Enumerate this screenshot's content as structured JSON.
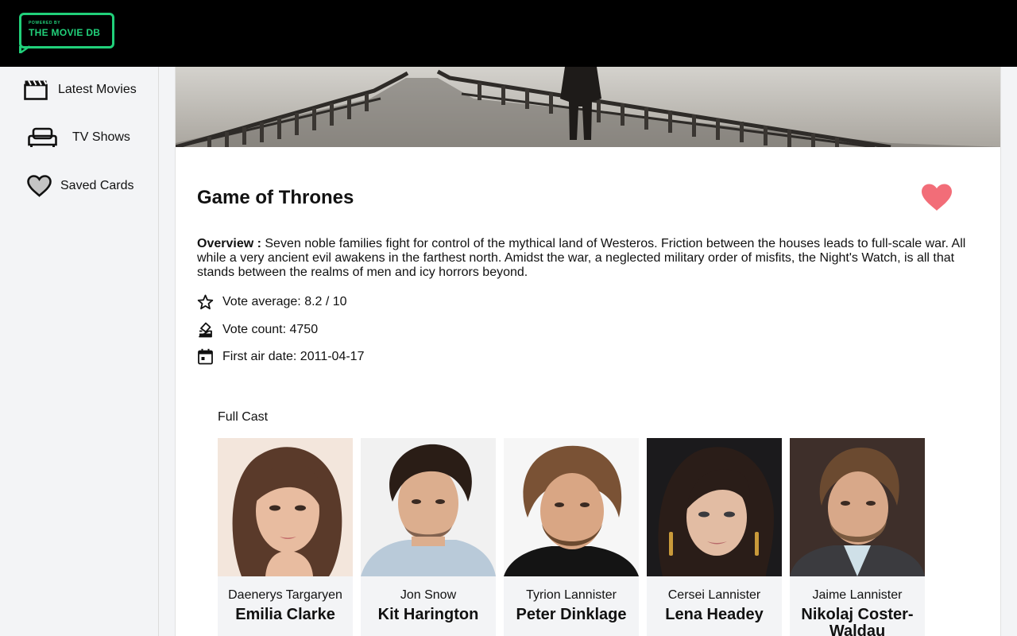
{
  "brand": {
    "logo_top": "POWERED BY",
    "logo_bottom": "THE MOVIE DB",
    "accent": "#21d07a"
  },
  "sidebar": {
    "items": [
      {
        "label": "Latest Movies",
        "icon": "clapperboard-icon"
      },
      {
        "label": "TV Shows",
        "icon": "couch-icon"
      },
      {
        "label": "Saved Cards",
        "icon": "heart-outline-icon"
      }
    ]
  },
  "show": {
    "title": "Game of Thrones",
    "overview_label": "Overview :",
    "overview_text": " Seven noble families fight for control of the mythical land of Westeros. Friction between the houses leads to full-scale war. All while a very ancient evil awakens in the farthest north. Amidst the war, a neglected military order of misfits, the Night's Watch, is all that stands between the realms of men and icy horrors beyond.",
    "vote_average": "Vote average: 8.2 / 10",
    "vote_count": "Vote count: 4750",
    "first_air_date": "First air date: 2011-04-17",
    "favorite_color": "#f26d78"
  },
  "cast": {
    "heading": "Full Cast",
    "members": [
      {
        "character": "Daenerys Targaryen",
        "actor": "Emilia Clarke"
      },
      {
        "character": "Jon Snow",
        "actor": "Kit Harington"
      },
      {
        "character": "Tyrion Lannister",
        "actor": "Peter Dinklage"
      },
      {
        "character": "Cersei Lannister",
        "actor": "Lena Headey"
      },
      {
        "character": "Jaime Lannister",
        "actor": "Nikolaj Coster-Waldau"
      }
    ]
  }
}
